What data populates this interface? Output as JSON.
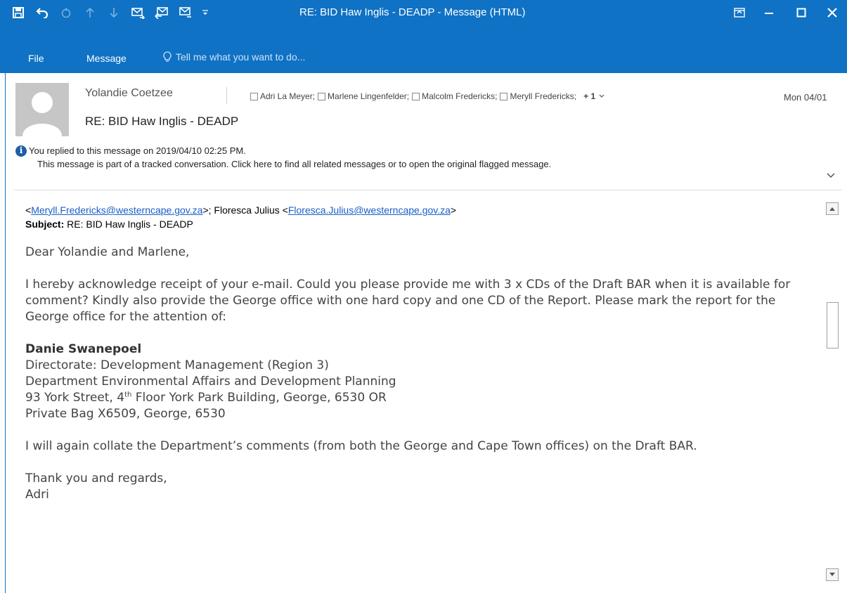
{
  "window": {
    "title": "RE: BID Haw Inglis - DEADP - Message (HTML)",
    "accent_color": "#0f72c4"
  },
  "quick_access": {
    "icons": [
      "save-icon",
      "undo-icon",
      "redo-icon",
      "up-arrow-icon",
      "down-arrow-icon",
      "reply-icon",
      "reply-all-icon",
      "forward-icon",
      "customize-icon"
    ]
  },
  "ribbon": {
    "tabs": [
      "File",
      "Message"
    ],
    "tell_me": "Tell me what you want to do..."
  },
  "header": {
    "sender": "Yolandie Coetzee",
    "recipients": [
      "Adri La Meyer;",
      "Marlene Lingenfelder;",
      "Malcolm Fredericks;",
      "Meryll Fredericks;"
    ],
    "more": "+ 1",
    "date": "Mon 04/01",
    "subject": "RE: BID Haw Inglis - DEADP",
    "info_line1": "You replied to this message on 2019/04/10 02:25 PM.",
    "info_line2": "This message is part of a tracked conversation. Click here to find all related messages or to open the original flagged message."
  },
  "body": {
    "header_prefix": "<",
    "email1": "Meryll.Fredericks@westerncape.gov.za",
    "mid_text": ">; Floresca Julius <",
    "email2": "Floresca.Julius@westerncape.gov.za",
    "suffix": ">",
    "subject_label": "Subject:",
    "subject_value": " RE: BID Haw Inglis - DEADP",
    "greeting": "Dear Yolandie and Marlene,",
    "para1": "I hereby acknowledge receipt of your e-mail. Could you please provide me with 3 x CDs of the Draft BAR when it is available for comment? Kindly also provide the George office with one hard copy and one CD of the Report. Please mark the report for the George office for the attention of:",
    "sig_name": "Danie Swanepoel",
    "sig_line1": "Directorate: Development Management (Region 3)",
    "sig_line2": "Department Environmental Affairs and Development Planning",
    "sig_line3_a": "93 York Street, 4",
    "sig_line3_sup": "th",
    "sig_line3_b": " Floor York Park Building, George, 6530 OR",
    "sig_line4": "Private Bag X6509, George, 6530",
    "para2": "I will again collate the Department’s comments (from both the George and Cape Town offices) on the Draft BAR.",
    "closing": "Thank you and regards,",
    "closing_name": "Adri"
  }
}
